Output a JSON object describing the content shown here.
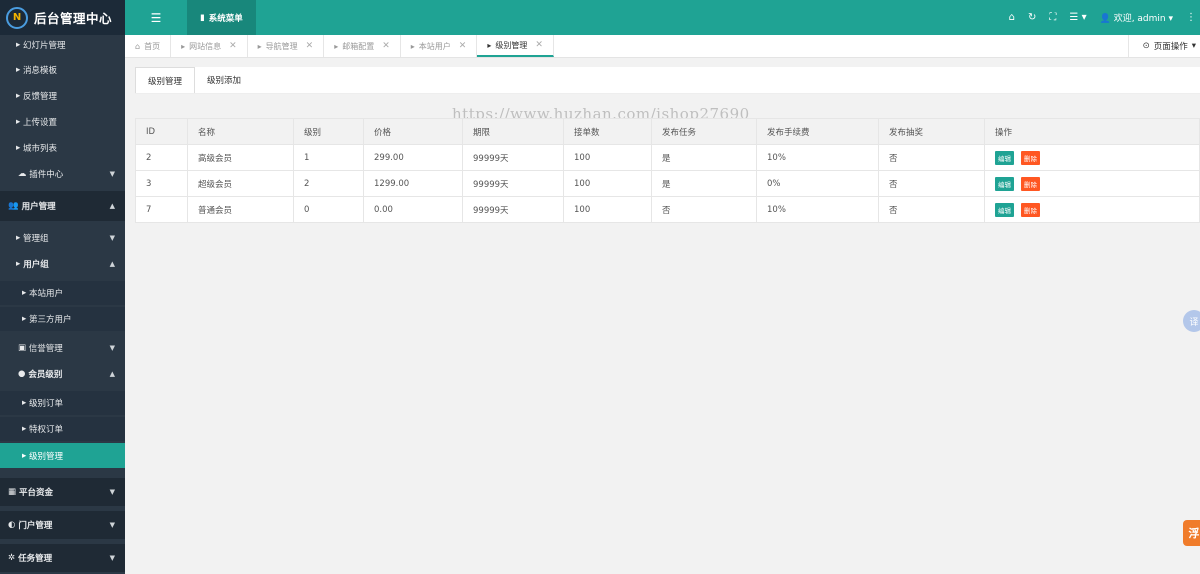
{
  "header": {
    "logo_mark": "N",
    "logo_text": "后台管理中心",
    "menu_toggle_icon": "☰",
    "system_menu_label": "系统菜单",
    "welcome": "欢迎, admin",
    "icons": [
      "home-icon",
      "refresh-icon",
      "fullscreen-icon",
      "list-icon"
    ]
  },
  "sidebar": {
    "items": [
      {
        "label": "幻灯片管理",
        "icon": "▸"
      },
      {
        "label": "消息模板",
        "icon": "▸"
      },
      {
        "label": "反馈管理",
        "icon": "▸"
      },
      {
        "label": "上传设置",
        "icon": "▸"
      },
      {
        "label": "城市列表",
        "icon": "▸"
      },
      {
        "label": "插件中心",
        "icon": "☁"
      },
      {
        "label": "用户管理",
        "icon": "👥"
      },
      {
        "label": "管理组",
        "icon": "▸"
      },
      {
        "label": "用户组",
        "icon": "▸"
      },
      {
        "label": "本站用户",
        "icon": "▸"
      },
      {
        "label": "第三方用户",
        "icon": "▸"
      },
      {
        "label": "信誉管理",
        "icon": "▣"
      },
      {
        "label": "会员级别",
        "icon": "●"
      },
      {
        "label": "级别订单",
        "icon": "▸"
      },
      {
        "label": "特权订单",
        "icon": "▸"
      },
      {
        "label": "级别管理",
        "icon": "▸"
      },
      {
        "label": "平台资金",
        "icon": "▦"
      },
      {
        "label": "门户管理",
        "icon": "◐"
      },
      {
        "label": "任务管理",
        "icon": "✲"
      }
    ]
  },
  "tabs": [
    {
      "label": "首页",
      "icon": "⌂"
    },
    {
      "label": "网站信息",
      "icon": "▸"
    },
    {
      "label": "导航管理",
      "icon": "▸"
    },
    {
      "label": "邮箱配置",
      "icon": "▸"
    },
    {
      "label": "本站用户",
      "icon": "▸"
    },
    {
      "label": "级别管理",
      "icon": "▸"
    }
  ],
  "page_ops_label": "页面操作",
  "subtabs": [
    "级别管理",
    "级别添加"
  ],
  "watermark": "https://www.huzhan.com/ishop27690",
  "table": {
    "headers": [
      "ID",
      "名称",
      "级别",
      "价格",
      "期限",
      "接单数",
      "发布任务",
      "发布手续费",
      "发布抽奖",
      "操作"
    ],
    "rows": [
      [
        "2",
        "高级会员",
        "1",
        "299.00",
        "99999天",
        "100",
        "是",
        "10%",
        "否"
      ],
      [
        "3",
        "超级会员",
        "2",
        "1299.00",
        "99999天",
        "100",
        "是",
        "0%",
        "否"
      ],
      [
        "7",
        "普通会员",
        "0",
        "0.00",
        "99999天",
        "100",
        "否",
        "10%",
        "否"
      ]
    ],
    "edit_label": "编辑",
    "delete_label": "删除"
  },
  "float_a": "译",
  "float_b": "浮",
  "colors": {
    "accent": "#1fa394",
    "sidebar": "#2b3845",
    "danger": "#ff5722"
  }
}
